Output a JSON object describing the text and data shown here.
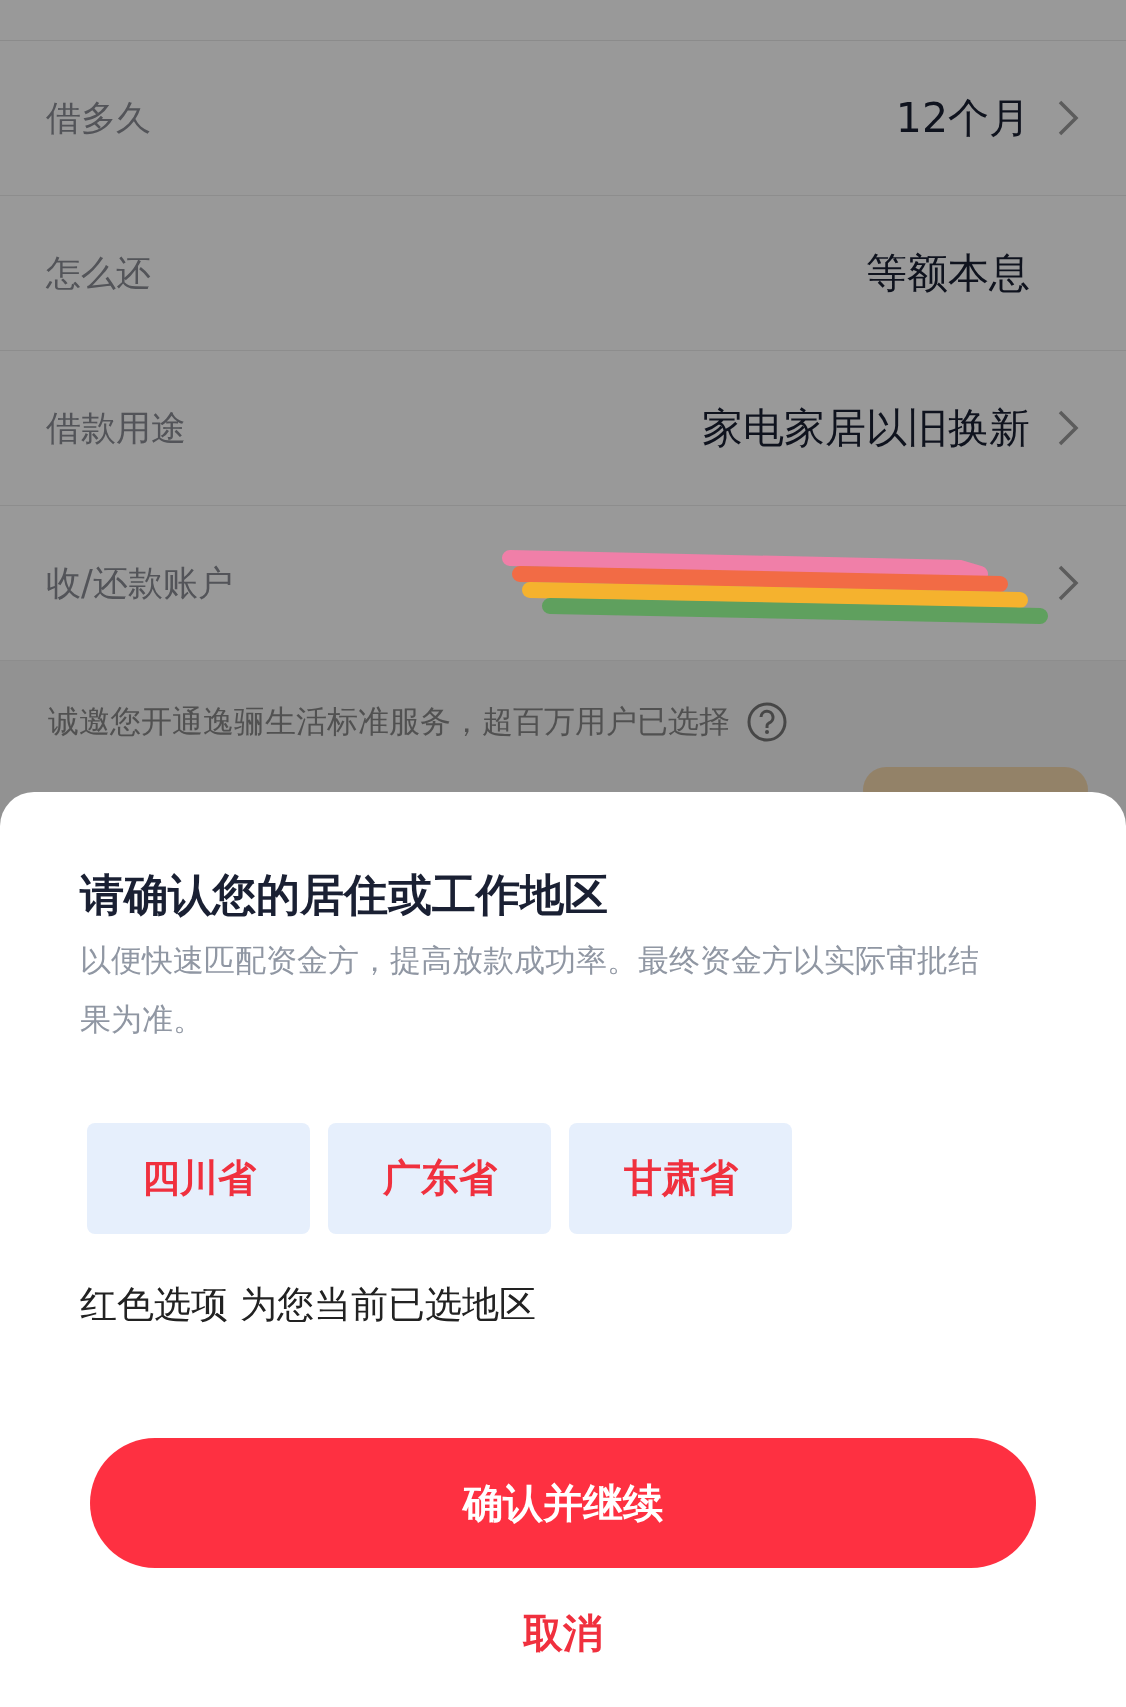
{
  "rows": [
    {
      "label": "借多久",
      "value": "12个月",
      "chevron": true
    },
    {
      "label": "怎么还",
      "value": "等额本息",
      "chevron": false
    },
    {
      "label": "借款用途",
      "value": "家电家居以旧换新",
      "chevron": true
    },
    {
      "label": "收/还款账户",
      "kind": "redacted",
      "chevron": true
    }
  ],
  "notice": {
    "text": "诚邀您开通逸骊生活标准服务，超百万用户已选择"
  },
  "sheet": {
    "title": "请确认您的居住或工作地区",
    "subtitle": "以便快速匹配资金方，提高放款成功率。最终资金方以实际审批结果为准。",
    "regions": [
      {
        "label": "四川省",
        "selected": true
      },
      {
        "label": "广东省",
        "selected": true
      },
      {
        "label": "甘肃省",
        "selected": true
      }
    ],
    "hint": "红色选项 为您当前已选地区",
    "confirm": "确认并继续",
    "cancel": "取消"
  }
}
